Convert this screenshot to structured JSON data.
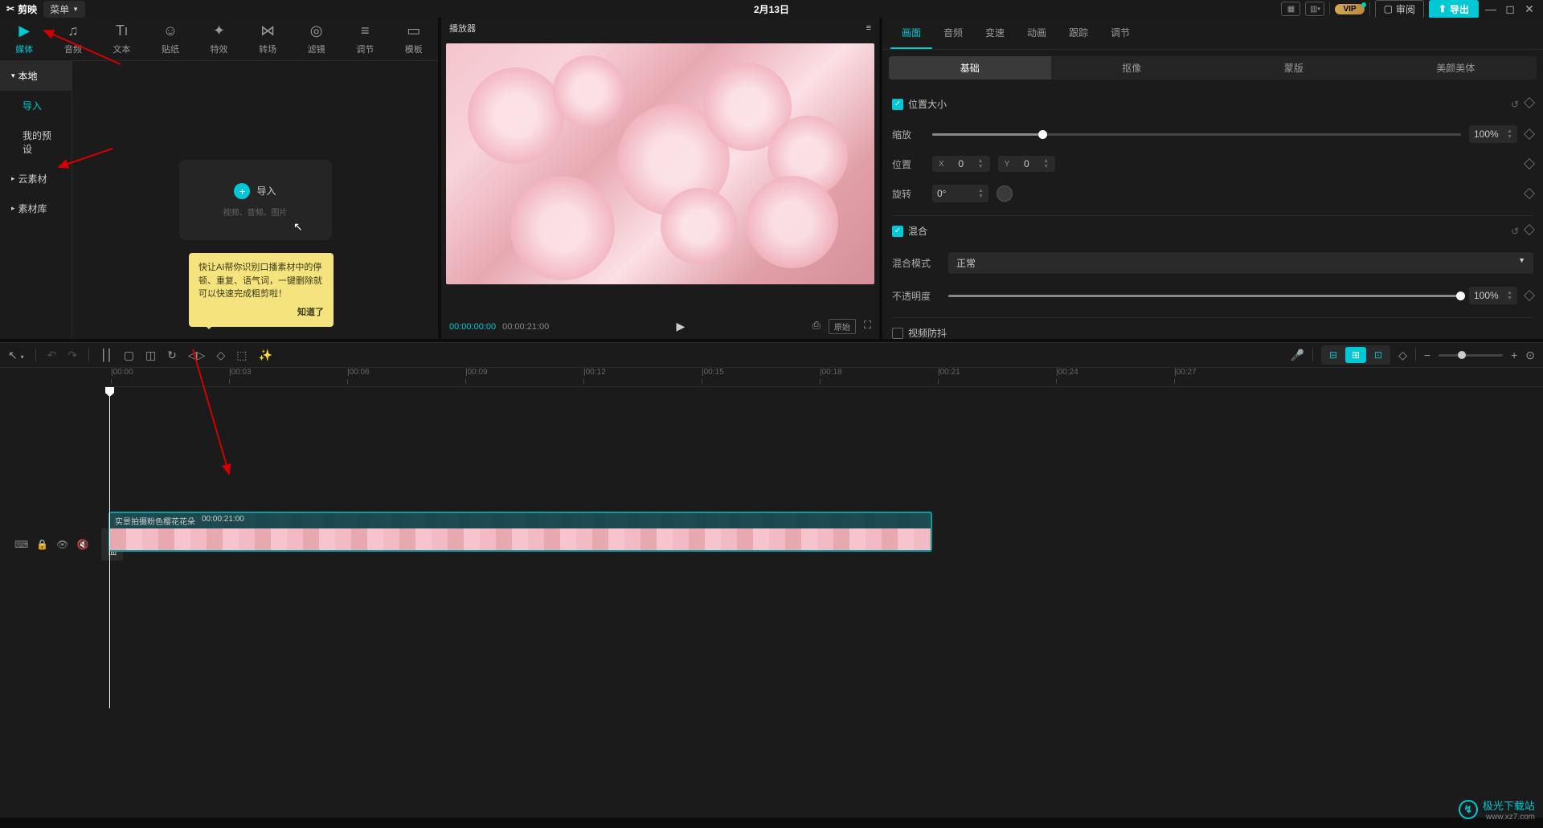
{
  "titlebar": {
    "app_name": "剪映",
    "menu_label": "菜单",
    "project_title": "2月13日",
    "vip": "VIP",
    "review": "审阅",
    "export": "导出"
  },
  "media_tabs": [
    {
      "icon": "▶",
      "label": "媒体"
    },
    {
      "icon": "♪",
      "label": "音频"
    },
    {
      "icon": "TI",
      "label": "文本"
    },
    {
      "icon": "✧",
      "label": "贴纸"
    },
    {
      "icon": "✦",
      "label": "特效"
    },
    {
      "icon": "⋈",
      "label": "转场"
    },
    {
      "icon": "◎",
      "label": "滤镜"
    },
    {
      "icon": "≡",
      "label": "调节"
    },
    {
      "icon": "▭",
      "label": "模板"
    }
  ],
  "sidebar": {
    "local": "本地",
    "import": "导入",
    "presets": "我的预设",
    "cloud": "云素材",
    "library": "素材库"
  },
  "import_box": {
    "label": "导入",
    "sub": "视频、音频、图片"
  },
  "ai_tooltip": {
    "text": "快让AI帮你识别口播素材中的停顿、重复、语气词，一键删除就可以快速完成粗剪啦！",
    "ok": "知道了"
  },
  "player": {
    "title": "播放器",
    "current": "00:00:00:00",
    "total": "00:00:21:00",
    "ratio": "原始"
  },
  "props": {
    "tabs": [
      "画面",
      "音频",
      "变速",
      "动画",
      "跟踪",
      "调节"
    ],
    "subtabs": [
      "基础",
      "抠像",
      "蒙版",
      "美颜美体"
    ],
    "pos_size": "位置大小",
    "scale": "缩放",
    "scale_val": "100%",
    "position": "位置",
    "pos_x": "0",
    "pos_y": "0",
    "rotate": "旋转",
    "rotate_val": "0°",
    "blend": "混合",
    "blend_mode": "混合模式",
    "blend_val": "正常",
    "opacity": "不透明度",
    "opacity_val": "100%",
    "stabilize": "视频防抖"
  },
  "clip": {
    "name": "实景拍摄粉色樱花花朵",
    "duration": "00:00:21:00"
  },
  "timeline": {
    "cover": "封面",
    "ticks": [
      "00:00",
      "00:03",
      "00:06",
      "00:09",
      "00:12",
      "00:15",
      "00:18",
      "00:21",
      "00:24",
      "00:27"
    ]
  },
  "watermark": {
    "name": "极光下载站",
    "url": "www.xz7.com"
  }
}
